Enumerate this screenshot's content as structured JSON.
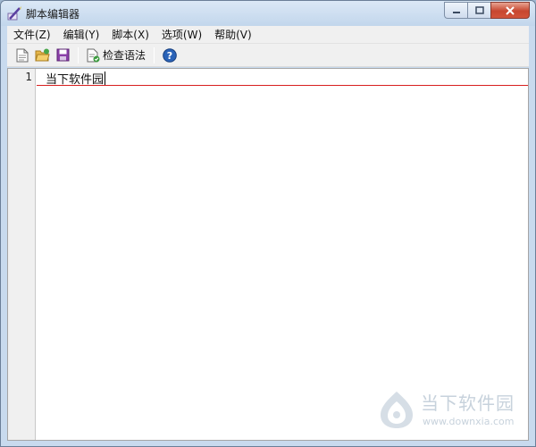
{
  "window": {
    "title": "脚本编辑器",
    "accent": "#c8daee"
  },
  "menu": [
    "文件(Z)",
    "编辑(Y)",
    "脚本(X)",
    "选项(W)",
    "帮助(V)"
  ],
  "toolbar": {
    "new_icon": "new-file-icon",
    "open_icon": "open-folder-icon",
    "save_icon": "save-icon",
    "check_label": "检查语法",
    "help_icon": "help-icon"
  },
  "editor": {
    "line_number": "1",
    "text": "当下软件园"
  },
  "watermark": {
    "title": "当下软件园",
    "url": "www.downxia.com"
  }
}
